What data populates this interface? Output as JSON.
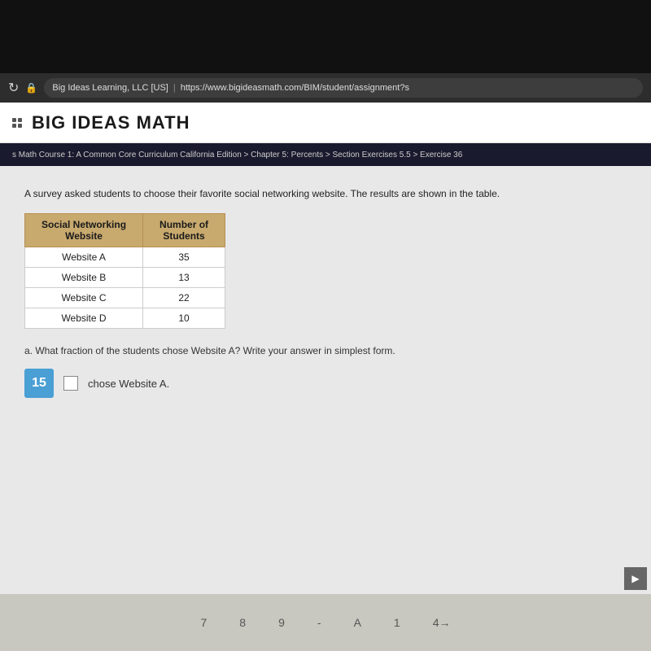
{
  "browser": {
    "refresh_icon": "↻",
    "lock_icon": "🔒",
    "url_site": "Big Ideas Learning, LLC [US]",
    "url_separator": "|",
    "url_path": "https://www.bigideasmath.com/BIM/student/assignment?s"
  },
  "header": {
    "title": "BIG IDEAS MATH"
  },
  "breadcrumb": {
    "text": "s Math Course 1: A Common Core Curriculum California Edition > Chapter 5: Percents > Section Exercises 5.5 > Exercise 36"
  },
  "problem": {
    "description": "A survey asked students to choose their favorite social networking website. The results are shown in the table.",
    "table": {
      "headers": [
        "Social Networking\nWebsite",
        "Number of\nStudents"
      ],
      "rows": [
        {
          "website": "Website A",
          "students": "35"
        },
        {
          "website": "Website B",
          "students": "13"
        },
        {
          "website": "Website C",
          "students": "22"
        },
        {
          "website": "Website D",
          "students": "10"
        }
      ]
    },
    "subquestion": "a. What fraction of the students chose Website A? Write your answer in simplest form.",
    "answer_number": "15",
    "answer_label": "chose Website A."
  },
  "bottom_numbers": [
    "7",
    "8",
    "9",
    "-",
    "A",
    "1",
    "4→"
  ]
}
